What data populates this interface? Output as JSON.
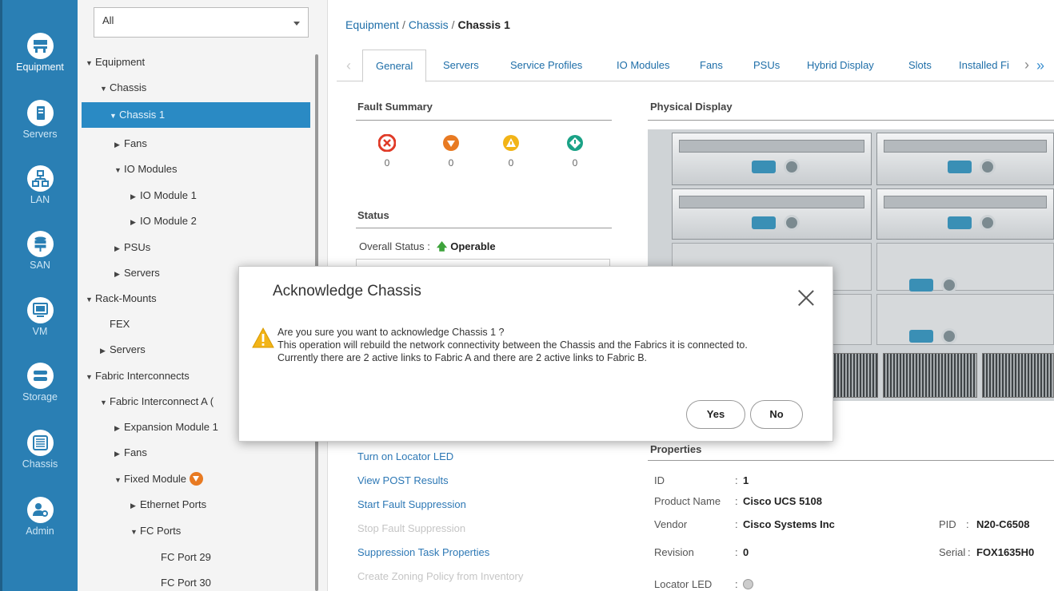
{
  "nav": [
    {
      "label": "Equipment",
      "icon": "equipment-icon"
    },
    {
      "label": "Servers",
      "icon": "server-icon"
    },
    {
      "label": "LAN",
      "icon": "lan-icon"
    },
    {
      "label": "SAN",
      "icon": "san-icon"
    },
    {
      "label": "VM",
      "icon": "vm-icon"
    },
    {
      "label": "Storage",
      "icon": "storage-icon"
    },
    {
      "label": "Chassis",
      "icon": "chassis-icon"
    },
    {
      "label": "Admin",
      "icon": "admin-icon"
    }
  ],
  "filter": {
    "value": "All"
  },
  "tree": [
    {
      "label": "Equipment",
      "arrow": "▼"
    },
    {
      "label": "Chassis",
      "arrow": "▼"
    },
    {
      "label": "Chassis 1",
      "arrow": "▼"
    },
    {
      "label": "Fans",
      "arrow": "▶"
    },
    {
      "label": "IO Modules",
      "arrow": "▼"
    },
    {
      "label": "IO Module 1",
      "arrow": "▶"
    },
    {
      "label": "IO Module 2",
      "arrow": "▶"
    },
    {
      "label": "PSUs",
      "arrow": "▶"
    },
    {
      "label": "Servers",
      "arrow": "▶"
    },
    {
      "label": "Rack-Mounts",
      "arrow": "▼"
    },
    {
      "label": "FEX",
      "arrow": ""
    },
    {
      "label": "Servers",
      "arrow": "▶"
    },
    {
      "label": "Fabric Interconnects",
      "arrow": "▼"
    },
    {
      "label": "Fabric Interconnect A (",
      "arrow": "▼"
    },
    {
      "label": "Expansion Module 1",
      "arrow": "▶"
    },
    {
      "label": "Fans",
      "arrow": "▶"
    },
    {
      "label": "Fixed Module",
      "arrow": "▼"
    },
    {
      "label": "Ethernet Ports",
      "arrow": "▶"
    },
    {
      "label": "FC Ports",
      "arrow": "▼"
    },
    {
      "label": "FC Port 29",
      "arrow": ""
    },
    {
      "label": "FC Port 30",
      "arrow": ""
    }
  ],
  "breadcrumb": {
    "part1": "Equipment",
    "sep": "/",
    "part2": "Chassis",
    "current": "Chassis 1"
  },
  "tabs": [
    "General",
    "Servers",
    "Service Profiles",
    "IO Modules",
    "Fans",
    "PSUs",
    "Hybrid Display",
    "Slots",
    "Installed Fi"
  ],
  "fault_summary": {
    "title": "Fault Summary",
    "counts": [
      {
        "severity": "critical",
        "value": "0",
        "color": "#e03a27"
      },
      {
        "severity": "major",
        "value": "0",
        "color": "#e87a22"
      },
      {
        "severity": "minor",
        "value": "0",
        "color": "#f2b417"
      },
      {
        "severity": "warning",
        "value": "0",
        "color": "#1aa286"
      }
    ]
  },
  "status": {
    "title": "Status",
    "label": "Overall Status :",
    "value": "Operable"
  },
  "physical_display": {
    "title": "Physical Display"
  },
  "actions": [
    {
      "label": "Turn on Locator LED",
      "enabled": true
    },
    {
      "label": "View POST Results",
      "enabled": true
    },
    {
      "label": "Start Fault Suppression",
      "enabled": true
    },
    {
      "label": "Stop Fault Suppression",
      "enabled": false
    },
    {
      "label": "Suppression Task Properties",
      "enabled": true
    },
    {
      "label": "Create Zoning Policy from Inventory",
      "enabled": false
    }
  ],
  "properties": {
    "title": "Properties",
    "id_label": "ID",
    "id_value": "1",
    "product_label": "Product Name",
    "product_value": "Cisco UCS 5108",
    "vendor_label": "Vendor",
    "vendor_value": "Cisco Systems Inc",
    "pid_label": "PID",
    "pid_value": "N20-C6508",
    "revision_label": "Revision",
    "revision_value": "0",
    "serial_label": "Serial",
    "serial_value": "FOX1635H0",
    "locator_label": "Locator LED"
  },
  "dialog": {
    "title": "Acknowledge Chassis",
    "line1": "Are you sure you want to acknowledge Chassis 1 ?",
    "line2": "This operation will rebuild the network connectivity between the Chassis and the Fabrics it is connected to.",
    "line3": "Currently there are 2 active links to Fabric A and there are 2 active links to Fabric B.",
    "yes": "Yes",
    "no": "No"
  },
  "colors": {
    "nav_bg": "#2a7fb4",
    "selected": "#2a8ac4",
    "link": "#1e6ea8"
  }
}
